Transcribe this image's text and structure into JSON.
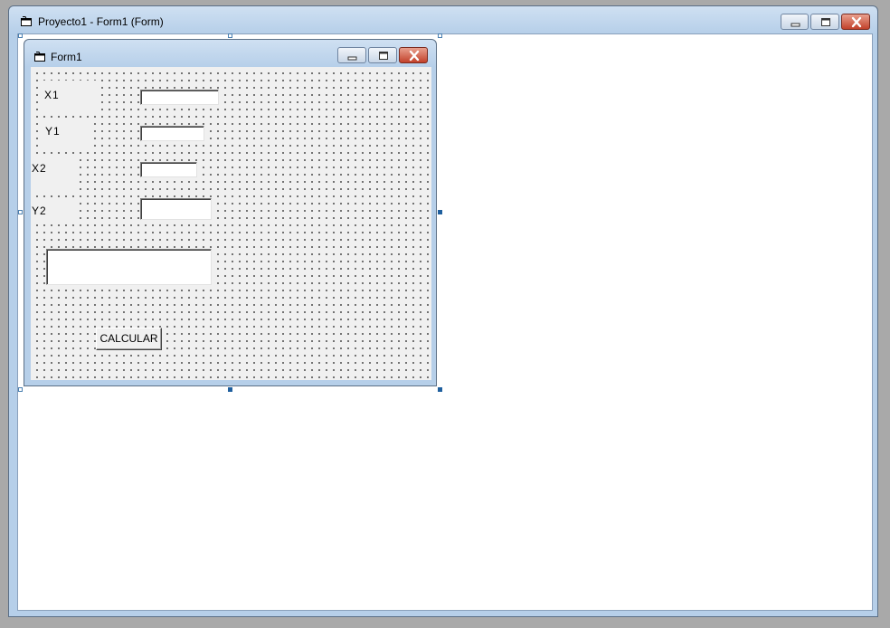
{
  "designer_window": {
    "title": "Proyecto1 - Form1 (Form)"
  },
  "form": {
    "title": "Form1",
    "labels": {
      "x1": "X1",
      "y1": "Y1",
      "x2": "X2",
      "y2": "Y2"
    },
    "textboxes": {
      "x1": "",
      "y1": "",
      "x2": "",
      "y2": "",
      "result": ""
    },
    "calculate_button": "CALCULAR"
  },
  "icons": {
    "window": "form-window-icon",
    "minimize": "minimize-icon",
    "maximize": "maximize-icon",
    "close": "close-icon"
  },
  "colors": {
    "title_bar": "#b6cfe9",
    "close_button": "#c2412b",
    "handle": "#1f5f9e",
    "form_background": "#f0f0f0"
  }
}
